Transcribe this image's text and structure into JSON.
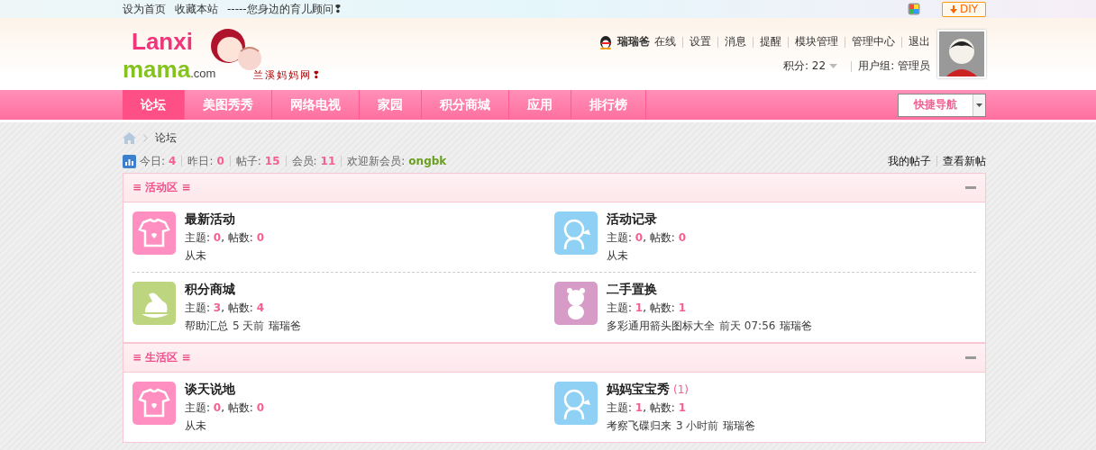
{
  "top_bar": {
    "links": [
      "设为首页",
      "收藏本站"
    ],
    "slogan": "-----您身边的育儿顾问❢",
    "diy_button": "DIY"
  },
  "logo": {
    "word_top": "Lanxi",
    "word_bottom": "mama",
    "suffix": ".com",
    "tagline": "兰溪妈妈网❢"
  },
  "user": {
    "name": "瑞瑞爸",
    "status": "在线",
    "links": [
      "设置",
      "消息",
      "提醒",
      "模块管理",
      "管理中心",
      "退出"
    ],
    "credits_label": "积分: 22",
    "group_label": "用户组: 管理员"
  },
  "nav": {
    "items": [
      {
        "label": "论坛",
        "selected": true
      },
      {
        "label": "美图秀秀",
        "selected": false
      },
      {
        "label": "网络电视",
        "selected": false
      },
      {
        "label": "家园",
        "selected": false
      },
      {
        "label": "积分商城",
        "selected": false
      },
      {
        "label": "应用",
        "selected": false
      },
      {
        "label": "排行榜",
        "selected": false
      }
    ],
    "quick_nav": "快捷导航"
  },
  "breadcrumb": {
    "current": "论坛"
  },
  "stats": {
    "items": [
      {
        "label": "今日:",
        "value": "4"
      },
      {
        "label": "昨日:",
        "value": "0"
      },
      {
        "label": "帖子:",
        "value": "15"
      },
      {
        "label": "会员:",
        "value": "11"
      }
    ],
    "welcome_label": "欢迎新会员:",
    "new_member": "ongbk",
    "links": [
      "我的帖子",
      "查看新帖"
    ]
  },
  "sections": [
    {
      "title": "≡ 活动区 ≡",
      "expanded": true,
      "forums": [
        {
          "name": "最新活动",
          "color": "#ff8fc0",
          "counts": "主题: **0**, 帖数: **0**",
          "last_post": {
            "never": "从未"
          }
        },
        {
          "name": "活动记录",
          "color": "#8fd0f5",
          "counts": "主题: **0**, 帖数: **0**",
          "last_post": {
            "never": "从未"
          }
        },
        {
          "name": "积分商城",
          "color": "#bcd57e",
          "counts": "主题: **3**, 帖数: **4**",
          "last_post": {
            "title": "帮助汇总",
            "time": "5 天前",
            "author": "瑞瑞爸"
          }
        },
        {
          "name": "二手置换",
          "color": "#d79bc8",
          "counts": "主题: **1**, 帖数: **1**",
          "last_post": {
            "title": "多彩通用箭头图标大全",
            "time": "前天 07:56",
            "author": "瑞瑞爸"
          }
        }
      ]
    },
    {
      "title": "≡ 生活区 ≡",
      "expanded": true,
      "forums": [
        {
          "name": "谈天说地",
          "color": "#ff8fc0",
          "counts": "主题: **0**, 帖数: **0**",
          "last_post": {
            "never": "从未"
          }
        },
        {
          "name": "妈妈宝宝秀",
          "today": "(1)",
          "color": "#8fd0f5",
          "counts": "主题: **1**, 帖数: **1**",
          "last_post": {
            "title": "考察飞碟归来",
            "time": "3 小时前",
            "author": "瑞瑞爸"
          }
        }
      ]
    }
  ]
}
